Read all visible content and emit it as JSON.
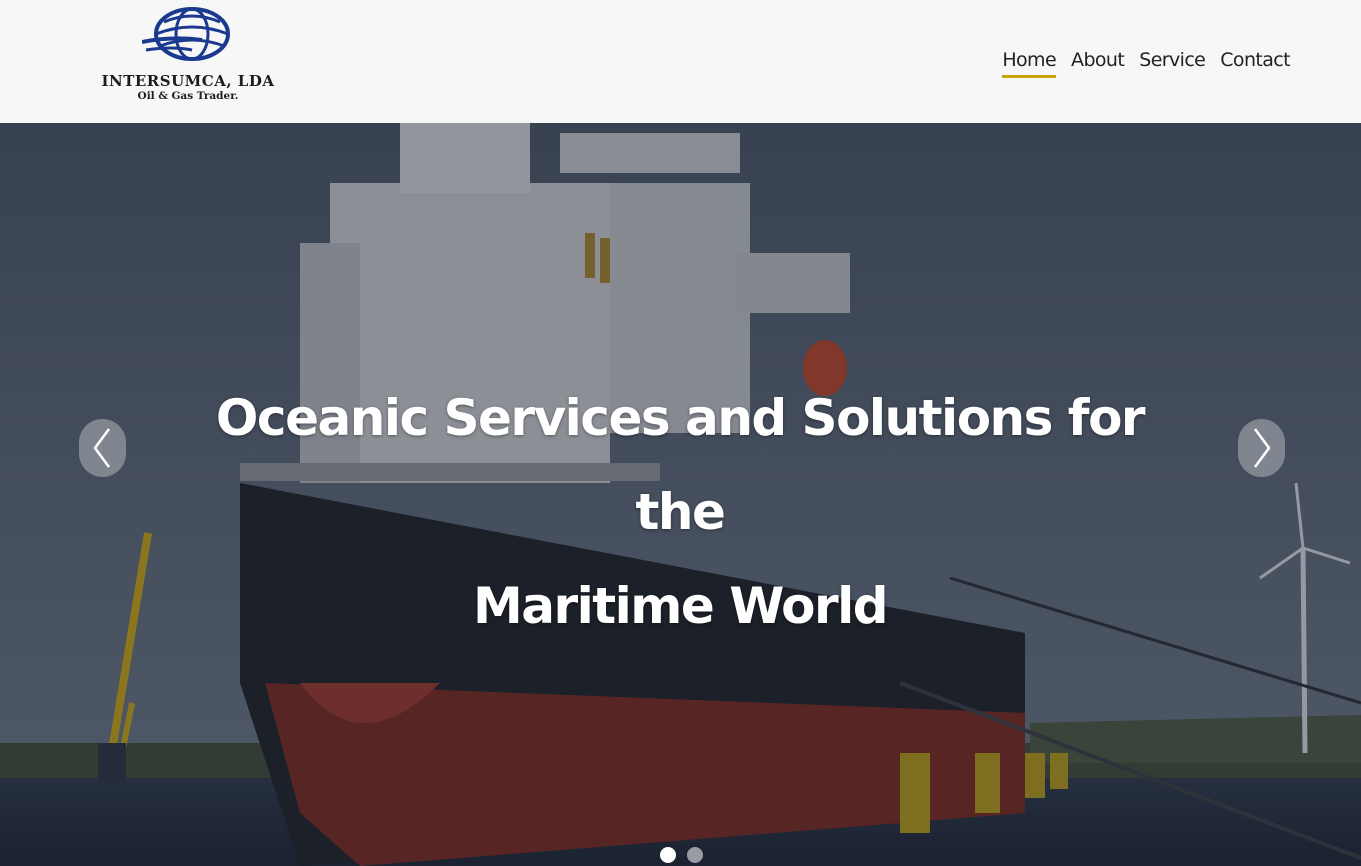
{
  "brand": {
    "name": "INTERSUMCA, LDA",
    "tagline": "Oil & Gas Trader.",
    "logo_icon": "globe-icon",
    "logo_color": "#1b3a8f"
  },
  "nav": {
    "items": [
      {
        "label": "Home",
        "active": true
      },
      {
        "label": "About",
        "active": false
      },
      {
        "label": "Service",
        "active": false
      },
      {
        "label": "Contact",
        "active": false
      }
    ],
    "active_underline_color": "#c9a508"
  },
  "hero": {
    "headline_line1": "Oceanic Services and Solutions for the",
    "headline_line2": "Maritime World",
    "prev_icon": "chevron-left-icon",
    "next_icon": "chevron-right-icon",
    "slides": [
      {
        "active": true
      },
      {
        "active": false
      }
    ]
  }
}
